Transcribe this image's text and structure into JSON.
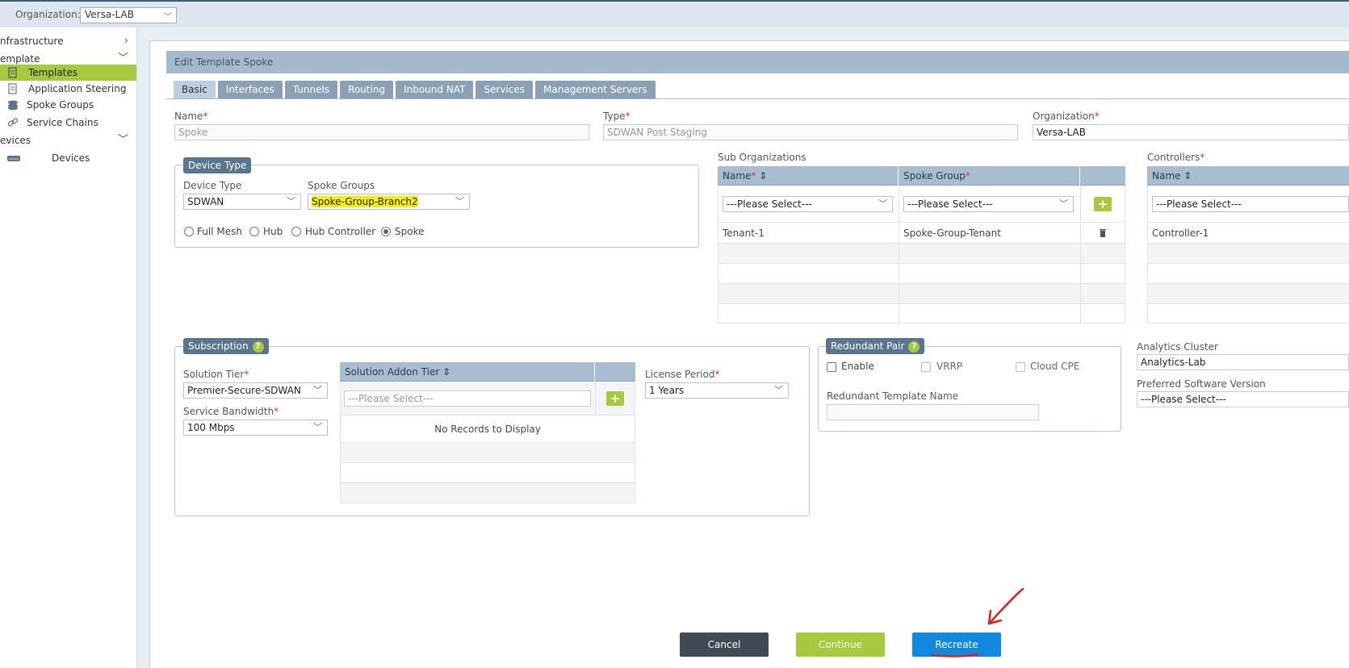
{
  "topbar": {
    "org_label": "Organization:",
    "org_value": "Versa-LAB"
  },
  "sidebar": {
    "items": [
      {
        "label": "nfrastructure"
      },
      {
        "label": "emplate"
      },
      {
        "label": "Templates"
      },
      {
        "label": "Application Steering"
      },
      {
        "label": "Spoke Groups"
      },
      {
        "label": "Service Chains"
      },
      {
        "label": "evices"
      },
      {
        "label": "Devices"
      }
    ]
  },
  "panel": {
    "title": "Edit Template Spoke",
    "tabs": [
      "Basic",
      "Interfaces",
      "Tunnels",
      "Routing",
      "Inbound NAT",
      "Services",
      "Management Servers"
    ]
  },
  "basic": {
    "name_label": "Name",
    "name_value": "Spoke",
    "type_label": "Type",
    "type_value": "SDWAN Post Staging",
    "org_label": "Organization",
    "org_value": "Versa-LAB"
  },
  "device_type": {
    "legend": "Device Type",
    "device_type_label": "Device Type",
    "device_type_value": "SDWAN",
    "spoke_groups_label": "Spoke Groups",
    "spoke_groups_value": "Spoke-Group-Branch2",
    "radios": [
      "Full Mesh",
      "Hub",
      "Hub Controller",
      "Spoke"
    ],
    "selected": "Spoke"
  },
  "sub_orgs": {
    "title": "Sub Organizations",
    "col_name": "Name",
    "col_spoke_group": "Spoke Group",
    "select_placeholder": "---Please Select---",
    "rows": [
      {
        "name": "Tenant-1",
        "spoke_group": "Spoke-Group-Tenant"
      }
    ]
  },
  "controllers": {
    "title": "Controllers",
    "col_name": "Name",
    "select_placeholder": "---Please Select---",
    "rows": [
      {
        "name": "Controller-1"
      }
    ]
  },
  "subscription": {
    "legend": "Subscription",
    "solution_tier_label": "Solution Tier",
    "solution_tier_value": "Premier-Secure-SDWAN",
    "bandwidth_label": "Service Bandwidth",
    "bandwidth_value": "100 Mbps",
    "addon_header": "Solution Addon Tier",
    "addon_placeholder": "---Please Select---",
    "no_records": "No Records to Display",
    "license_label": "License Period",
    "license_value": "1 Years"
  },
  "redundant": {
    "legend": "Redundant Pair",
    "enable": "Enable",
    "vrrp": "VRRP",
    "cloud_cpe": "Cloud CPE",
    "template_name_label": "Redundant Template Name"
  },
  "analytics": {
    "cluster_label": "Analytics Cluster",
    "cluster_value": "Analytics-Lab",
    "software_label": "Preferred Software Version",
    "software_value": "---Please Select---"
  },
  "buttons": {
    "cancel": "Cancel",
    "continue": "Continue",
    "recreate": "Recreate"
  },
  "colors": {
    "accent_green": "#a6c93e",
    "primary_blue": "#1289e0",
    "dark": "#3f4a55",
    "annotation_red": "#e02020"
  }
}
